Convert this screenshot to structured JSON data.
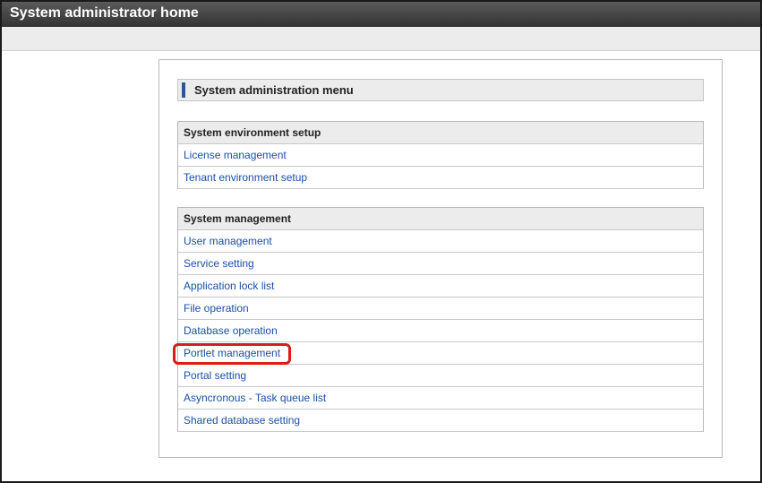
{
  "window": {
    "title": "System administrator home"
  },
  "menu": {
    "heading": "System administration menu"
  },
  "sections": [
    {
      "header": "System environment setup",
      "items": [
        "License management",
        "Tenant environment setup"
      ]
    },
    {
      "header": "System management",
      "items": [
        "User management",
        "Service setting",
        "Application lock list",
        "File operation",
        "Database operation",
        "Portlet management",
        "Portal setting",
        "Asyncronous - Task queue list",
        "Shared database setting"
      ]
    }
  ],
  "highlighted_item": "Portlet management",
  "colors": {
    "title_bar": "#3c3c3c",
    "link": "#1a4fa5",
    "highlight": "#d91c1c",
    "accent": "#2f5597"
  }
}
